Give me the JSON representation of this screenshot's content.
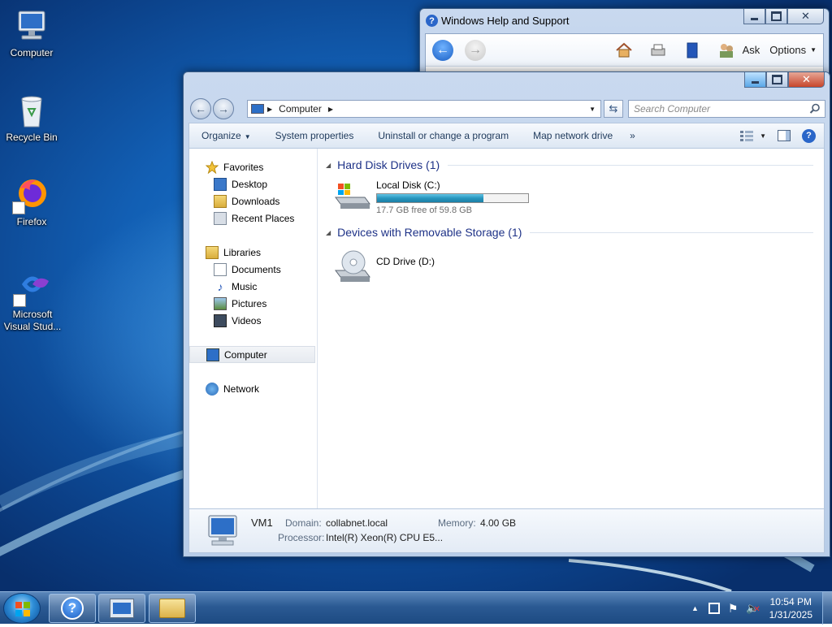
{
  "desktop": {
    "icons": [
      {
        "label": "Computer"
      },
      {
        "label": "Recycle Bin"
      },
      {
        "label": "Firefox"
      },
      {
        "label": "Microsoft Visual Stud..."
      }
    ]
  },
  "help_window": {
    "title": "Windows Help and Support",
    "ask_label": "Ask",
    "options_label": "Options"
  },
  "explorer": {
    "breadcrumb": [
      "Computer"
    ],
    "search_placeholder": "Search Computer",
    "commands": {
      "organize": "Organize",
      "system_properties": "System properties",
      "uninstall": "Uninstall or change a program",
      "map_drive": "Map network drive",
      "more": "»"
    },
    "nav": {
      "favorites": "Favorites",
      "desktop": "Desktop",
      "downloads": "Downloads",
      "recent_places": "Recent Places",
      "libraries": "Libraries",
      "documents": "Documents",
      "music": "Music",
      "pictures": "Pictures",
      "videos": "Videos",
      "computer": "Computer",
      "network": "Network"
    },
    "groups": {
      "hdd": "Hard Disk Drives (1)",
      "removable": "Devices with Removable Storage (1)"
    },
    "drives": {
      "local_disk": {
        "name": "Local Disk (C:)",
        "free_text": "17.7 GB free of 59.8 GB",
        "used_fraction": 0.704
      },
      "cd_drive": {
        "name": "CD Drive (D:)"
      }
    },
    "details": {
      "name": "VM1",
      "domain_label": "Domain:",
      "domain": "collabnet.local",
      "memory_label": "Memory:",
      "memory": "4.00 GB",
      "processor_label": "Processor:",
      "processor": "Intel(R) Xeon(R) CPU E5..."
    }
  },
  "taskbar": {
    "time": "10:54 PM",
    "date": "1/31/2025"
  },
  "colors": {
    "group_heading": "#1e3287",
    "accent": "#2896be"
  }
}
